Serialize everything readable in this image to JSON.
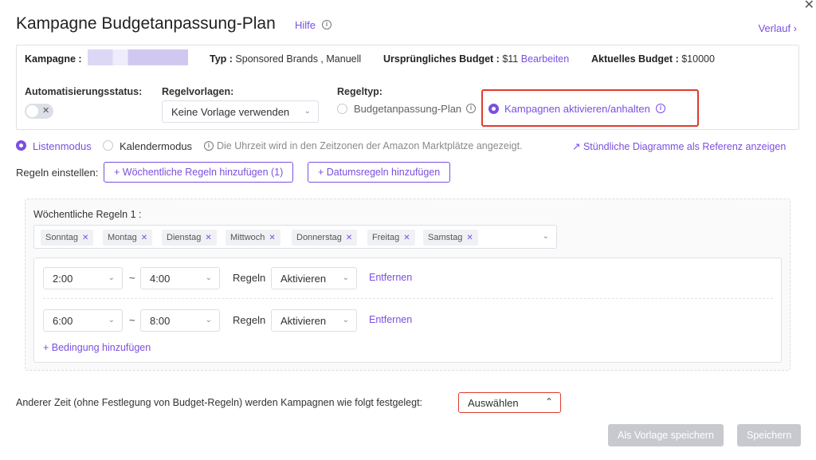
{
  "header": {
    "title": "Kampagne Budgetanpassung-Plan",
    "help": "Hilfe",
    "history": "Verlauf ›",
    "close": "✕"
  },
  "campaign": {
    "campaign_label": "Kampagne :",
    "type_label": "Typ :",
    "type_value": "Sponsored Brands , Manuell",
    "orig_budget_label": "Ursprüngliches Budget :",
    "orig_budget_value": "$11",
    "edit": "Bearbeiten",
    "current_budget_label": "Aktuelles Budget :",
    "current_budget_value": "$10000"
  },
  "automation": {
    "status_label": "Automatisierungsstatus:",
    "toggle_x": "✕",
    "templates_label": "Regelvorlagen:",
    "template_value": "Keine Vorlage verwenden",
    "rule_type_label": "Regeltyp:",
    "rule_type_options": [
      "Budgetanpassung-Plan",
      "Kampagnen aktivieren/anhalten"
    ],
    "rule_type_selected": 1
  },
  "mode": {
    "list": "Listenmodus",
    "calendar": "Kalendermodus",
    "info": "Die Uhrzeit wird in den Zeitzonen der Amazon Marktplätze angezeigt.",
    "chart_link": "Stündliche Diagramme als Referenz anzeigen"
  },
  "rules": {
    "label": "Regeln einstellen:",
    "add_weekly": "+ Wöchentliche Regeln hinzufügen (1)",
    "add_date": "+ Datumsregeln hinzufügen"
  },
  "weekly": {
    "title": "Wöchentliche Regeln 1 :",
    "days": [
      "Sonntag",
      "Montag",
      "Dienstag",
      "Mittwoch",
      "Donnerstag",
      "Freitag",
      "Samstag"
    ],
    "tilde": "~",
    "rules_word": "Regeln",
    "conditions": [
      {
        "from": "2:00",
        "to": "4:00",
        "action": "Aktivieren",
        "remove": "Entfernen"
      },
      {
        "from": "6:00",
        "to": "8:00",
        "action": "Aktivieren",
        "remove": "Entfernen"
      }
    ],
    "add_condition": "+ Bedingung hinzufügen"
  },
  "footer": {
    "other_time_label": "Anderer Zeit (ohne Festlegung von Budget-Regeln) werden Kampagnen wie folgt festgelegt:",
    "select_value": "Auswählen",
    "save_template": "Als Vorlage speichern",
    "save": "Speichern"
  },
  "colors": {
    "accent": "#7b4fe0",
    "highlight": "#e03b2e",
    "disabled": "#c7c9cf"
  }
}
